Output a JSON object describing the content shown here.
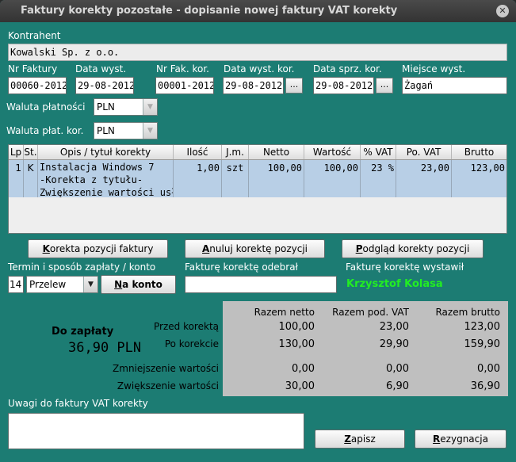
{
  "window": {
    "title": "Faktury korekty pozostałe - dopisanie nowej faktury VAT korekty"
  },
  "kontrahent": {
    "label": "Kontrahent",
    "value": "Kowalski Sp. z o.o."
  },
  "fields": {
    "nr_faktury": {
      "label": "Nr Faktury",
      "value": "00060-2012"
    },
    "data_wyst": {
      "label": "Data wyst.",
      "value": "29-08-2012"
    },
    "nr_fak_kor": {
      "label": "Nr Fak. kor.",
      "value": "00001-2012"
    },
    "data_wyst_kor": {
      "label": "Data wyst. kor.",
      "value": "29-08-2012"
    },
    "data_sprz_kor": {
      "label": "Data sprz. kor.",
      "value": "29-08-2012"
    },
    "miejsce_wyst": {
      "label": "Miejsce wyst.",
      "value": "Żagań"
    },
    "dots": "..."
  },
  "waluta_platnosci": {
    "label": "Waluta płatności",
    "value": "PLN"
  },
  "waluta_plat_kor": {
    "label": "Waluta płat. kor.",
    "value": "PLN"
  },
  "table": {
    "headers": [
      "Lp",
      "St.",
      "Opis / tytuł korekty",
      "Ilość",
      "J.m.",
      "Netto",
      "Wartość",
      "% VAT",
      "Po. VAT",
      "Brutto"
    ],
    "rows": [
      {
        "lp": "1",
        "st": "K",
        "opis": [
          "Instalacja Windows 7",
          "-Korekta z tytułu-",
          "Zwiększenie wartości usł"
        ],
        "ilosc": "1,00",
        "jm": "szt",
        "netto": "100,00",
        "wartosc": "100,00",
        "vat": "23 %",
        "po_vat": "23,00",
        "brutto": "123,00"
      }
    ]
  },
  "buttons": {
    "korekta_first": "K",
    "korekta_rest": "orekta pozycji faktury",
    "anuluj_first": "A",
    "anuluj_rest": "nuluj korektę pozycji",
    "podglad_first": "P",
    "podglad_rest": "odgląd korekty pozycji",
    "na_konto_first": "N",
    "na_konto_rest": "a konto",
    "zapisz_first": "Z",
    "zapisz_rest": "apisz",
    "rezygnacja_first": "R",
    "rezygnacja_rest": "ezygnacja"
  },
  "payment": {
    "termin_label": "Termin i sposób zapłaty / konto",
    "termin_value": "14",
    "sposob_value": "Przelew"
  },
  "odebral": {
    "label": "Fakturę korektę odebrał",
    "value": ""
  },
  "wystawil": {
    "label": "Fakturę korektę wystawił",
    "value": "Krzysztof Kolasa",
    "color": "#22ee22"
  },
  "do_zaplaty": {
    "label": "Do zapłaty",
    "value": "36,90 PLN"
  },
  "summary": {
    "headers": [
      "Razem netto",
      "Razem pod. VAT",
      "Razem brutto"
    ],
    "rows": [
      {
        "label": "Przed korektą",
        "netto": "100,00",
        "vat": "23,00",
        "brutto": "123,00"
      },
      {
        "label": "Po korekcie",
        "netto": "130,00",
        "vat": "29,90",
        "brutto": "159,90"
      },
      {
        "label": "Zmniejszenie wartości",
        "netto": "0,00",
        "vat": "0,00",
        "brutto": "0,00"
      },
      {
        "label": "Zwiększenie wartości",
        "netto": "30,00",
        "vat": "6,90",
        "brutto": "36,90"
      }
    ]
  },
  "uwagi": {
    "label": "Uwagi do faktury VAT korekty",
    "value": ""
  },
  "colors": {
    "background": "#1c7c73",
    "selection": "#b8cfe6",
    "summary_bg": "#bfbfbf"
  }
}
